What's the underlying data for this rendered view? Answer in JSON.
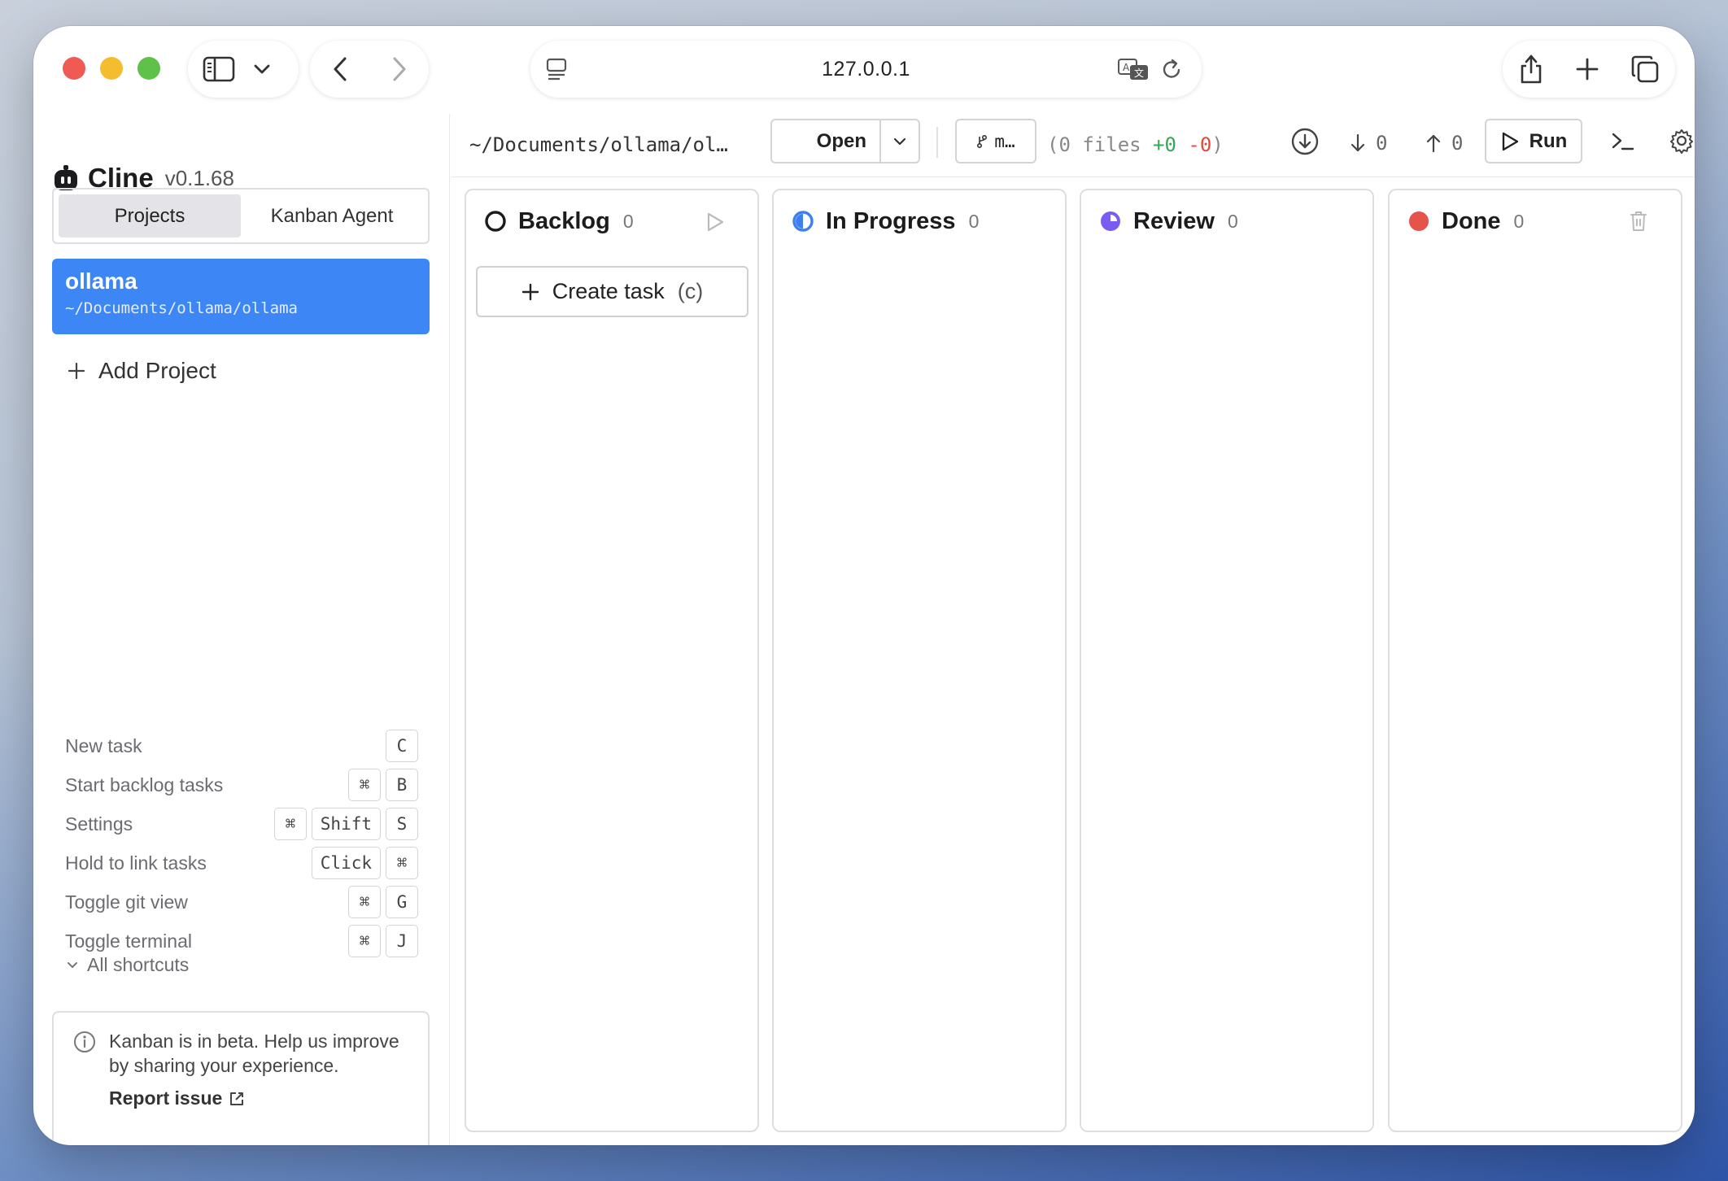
{
  "browser": {
    "url": "127.0.0.1"
  },
  "sidebar": {
    "brand": {
      "name": "Cline",
      "version": "v0.1.68"
    },
    "tabs": [
      {
        "label": "Projects",
        "active": true
      },
      {
        "label": "Kanban Agent",
        "active": false
      }
    ],
    "project": {
      "name": "ollama",
      "path": "~/Documents/ollama/ollama"
    },
    "add_project_label": "Add Project",
    "shortcuts": [
      {
        "label": "New task",
        "keys": [
          "C"
        ]
      },
      {
        "label": "Start backlog tasks",
        "keys": [
          "⌘",
          "B"
        ]
      },
      {
        "label": "Settings",
        "keys": [
          "⌘",
          "Shift",
          "S"
        ]
      },
      {
        "label": "Hold to link tasks",
        "keys": [
          "Click",
          "⌘"
        ]
      },
      {
        "label": "Toggle git view",
        "keys": [
          "⌘",
          "G"
        ]
      },
      {
        "label": "Toggle terminal",
        "keys": [
          "⌘",
          "J"
        ]
      }
    ],
    "all_shortcuts_label": "All shortcuts",
    "beta": {
      "message": "Kanban is in beta. Help us improve by sharing your experience.",
      "link_label": "Report issue"
    }
  },
  "toolbar": {
    "path": "~/Documents/ollama/ol…",
    "open_label": "Open",
    "branch_label": "m…",
    "diff": {
      "prefix": "(0 files ",
      "added": "+0",
      "removed": "-0",
      "suffix": ")"
    },
    "behind_count": "0",
    "ahead_count": "0",
    "run_label": "Run"
  },
  "board": {
    "columns": [
      {
        "title": "Backlog",
        "count": "0",
        "color": "#1c1c1e"
      },
      {
        "title": "In Progress",
        "count": "0",
        "color": "#3d7ff2"
      },
      {
        "title": "Review",
        "count": "0",
        "color": "#7b5cf0"
      },
      {
        "title": "Done",
        "count": "0",
        "color": "#e5534b"
      }
    ],
    "create_task": {
      "label": "Create task",
      "shortcut": "(c)"
    }
  }
}
